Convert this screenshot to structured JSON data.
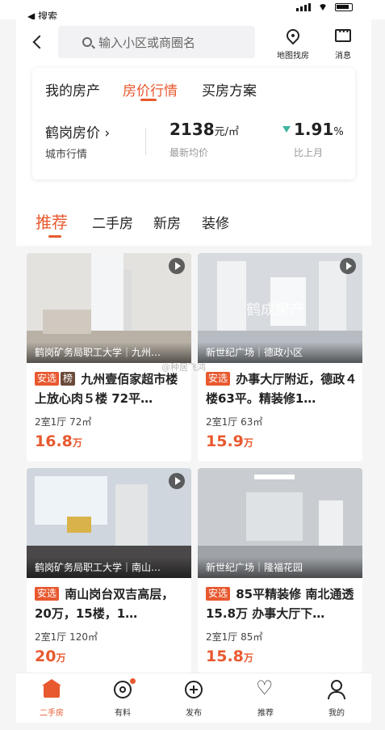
{
  "status_bar": {
    "back_app": "◀ 搜索"
  },
  "header": {
    "search_placeholder": "输入小区或商圈名",
    "map_label": "地图找房",
    "message_label": "消息"
  },
  "price_panel": {
    "tabs": [
      {
        "label": "我的房产",
        "active": false
      },
      {
        "label": "房价行情",
        "active": true
      },
      {
        "label": "买房方案",
        "active": false
      }
    ],
    "city_title": "鹤岗房价 ›",
    "city_sub": "城市行情",
    "avg_price": "2138",
    "avg_unit": "元/㎡",
    "avg_label": "最新均价",
    "change_value": "1.91",
    "change_unit": "%",
    "change_label": "比上月",
    "trend_color": "#3fb59f"
  },
  "categories": [
    {
      "label": "推荐",
      "active": true
    },
    {
      "label": "二手房",
      "active": false
    },
    {
      "label": "新房",
      "active": false
    },
    {
      "label": "装修",
      "active": false
    }
  ],
  "listings": [
    {
      "location": "鹤岗矿务局职工大学｜九州…",
      "tags": [
        "安选",
        "榜"
      ],
      "title": "九州壹佰家超市楼上放心肉５楼 72平…",
      "meta": "2室1厅 72㎡",
      "price": "16.8",
      "price_unit": "万"
    },
    {
      "location": "新世纪广场｜德政小区",
      "tags": [
        "安选"
      ],
      "title": "办事大厅附近，德政４楼63平。精装修1…",
      "meta": "2室1厅 63㎡",
      "price": "15.9",
      "price_unit": "万",
      "watermark": "鹤成房产"
    },
    {
      "location": "鹤岗矿务局职工大学｜南山…",
      "tags": [
        "安选"
      ],
      "title": "南山岗台双吉高层，20万，15楼，1…",
      "meta": "2室1厅 120㎡",
      "price": "20",
      "price_unit": "万"
    },
    {
      "location": "新世纪广场｜隆福花园",
      "tags": [
        "安选"
      ],
      "title": "85平精装修 南北通透 15.8万 办事大厅下…",
      "meta": "2室1厅 85㎡",
      "price": "15.8",
      "price_unit": "万"
    }
  ],
  "weibo_watermark": "@种居飞鸿",
  "tabbar": [
    {
      "label": "二手房",
      "icon": "home-icon",
      "active": true
    },
    {
      "label": "有料",
      "icon": "discover-icon",
      "active": false
    },
    {
      "label": "发布",
      "icon": "plus-circle-icon",
      "active": false
    },
    {
      "label": "推荐",
      "icon": "heart-icon",
      "active": false
    },
    {
      "label": "我的",
      "icon": "user-icon",
      "active": false
    }
  ],
  "colors": {
    "accent": "#e8592f",
    "rank_tag": "#6b4a3a"
  }
}
